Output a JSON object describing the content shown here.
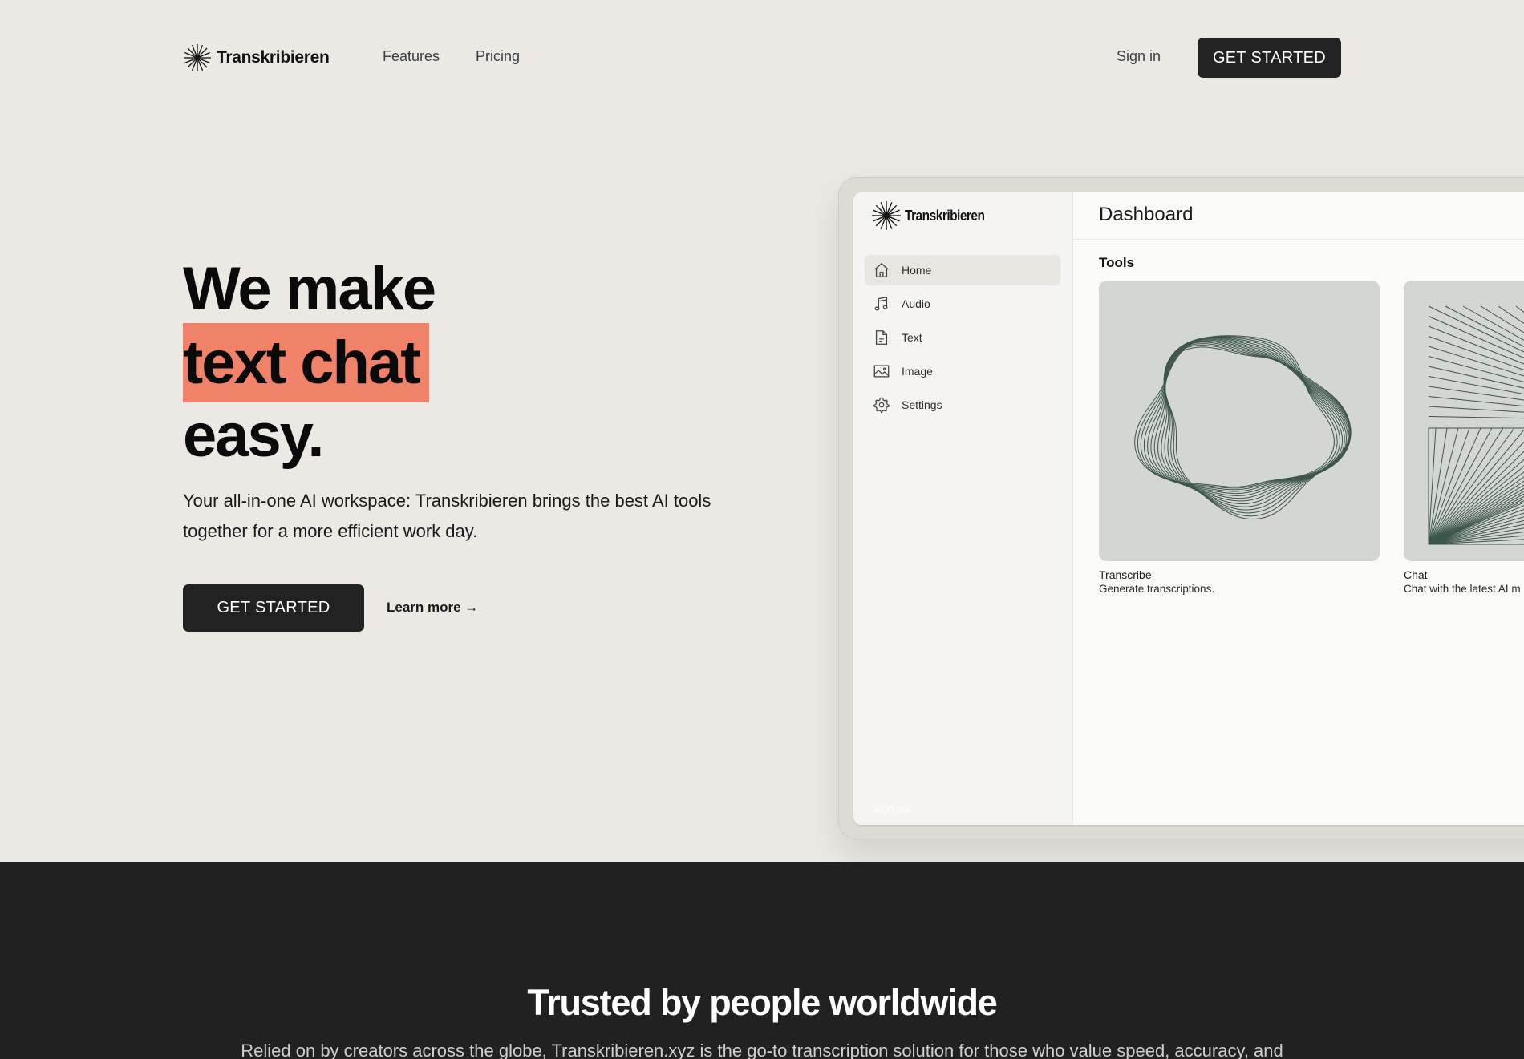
{
  "nav": {
    "brand": "Transkribieren",
    "links": [
      "Features",
      "Pricing"
    ],
    "sign_in": "Sign in",
    "cta": "GET STARTED"
  },
  "hero": {
    "headline_line1": "We make",
    "headline_highlight": "text chat",
    "headline_line3": "easy.",
    "subtext": "Your all-in-one AI workspace: Transkribieren brings the best AI tools together for a more efficient work day.",
    "cta": "GET STARTED",
    "learn_more": "Learn more →",
    "highlight_color": "#f0826a"
  },
  "app_preview": {
    "brand": "Transkribieren",
    "title": "Dashboard",
    "sidebar": [
      {
        "label": "Home",
        "icon": "home-icon",
        "active": true
      },
      {
        "label": "Audio",
        "icon": "music-note-icon",
        "active": false
      },
      {
        "label": "Text",
        "icon": "document-icon",
        "active": false
      },
      {
        "label": "Image",
        "icon": "image-icon",
        "active": false
      },
      {
        "label": "Settings",
        "icon": "gear-icon",
        "active": false
      }
    ],
    "sign_out": "Sign out",
    "section_label": "Tools",
    "cards": [
      {
        "title": "Transcribe",
        "description": "Generate transcriptions."
      },
      {
        "title": "Chat",
        "description": "Chat with the latest AI m"
      }
    ]
  },
  "trusted": {
    "title": "Trusted by people worldwide",
    "subtitle": "Relied on by creators across the globe, Transkribieren.xyz is the go-to transcription solution for those who value speed, accuracy, and"
  }
}
